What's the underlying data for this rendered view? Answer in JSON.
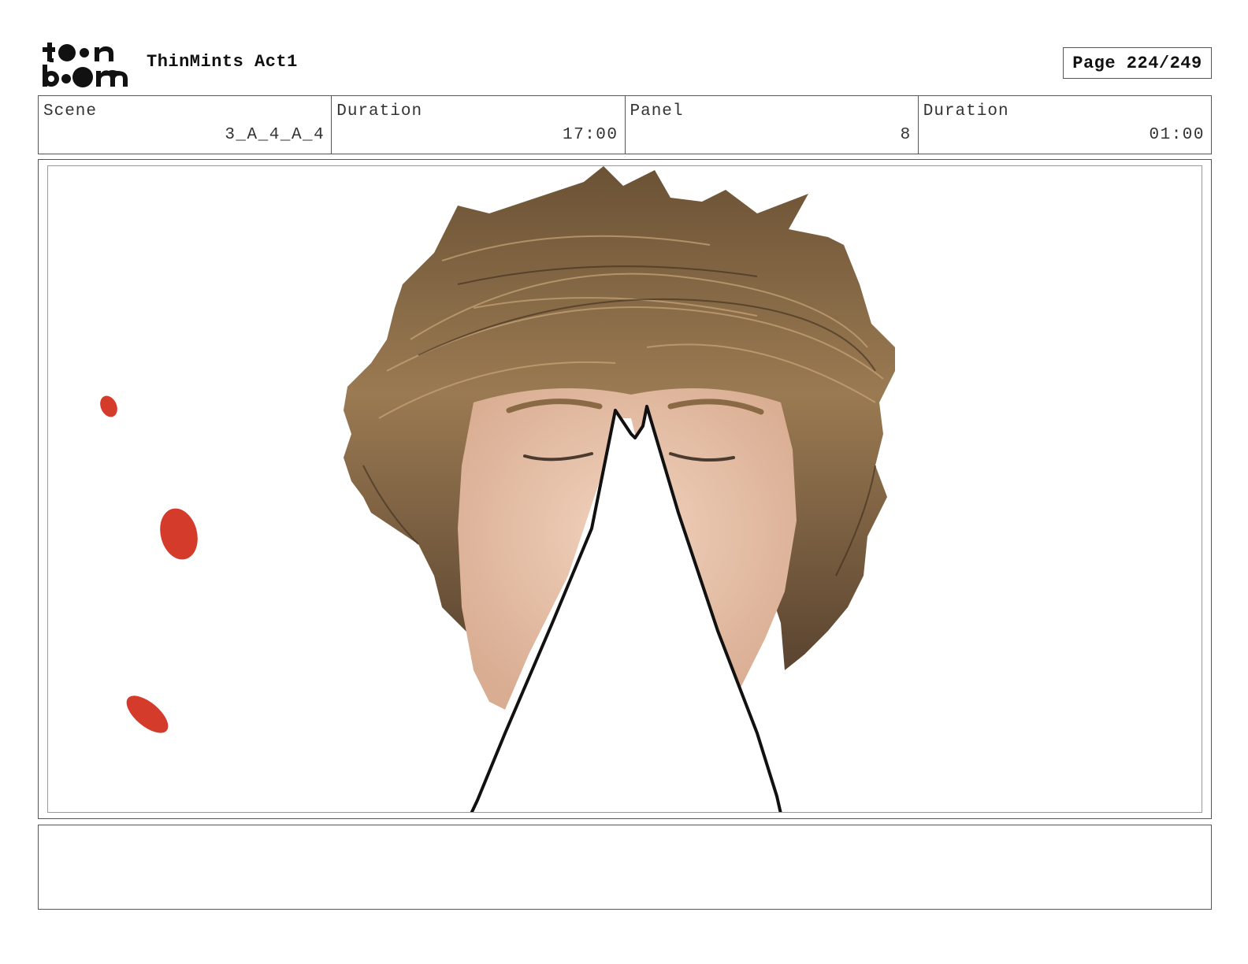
{
  "header": {
    "project_title": "ThinMints Act1",
    "page_label": "Page 224/249"
  },
  "info": {
    "scene_label": "Scene",
    "scene_value": "3_A_4_A_4",
    "scene_duration_label": "Duration",
    "scene_duration_value": "17:00",
    "panel_label": "Panel",
    "panel_value": "8",
    "panel_duration_label": "Duration",
    "panel_duration_value": "01:00"
  },
  "notes": {
    "text": ""
  },
  "colors": {
    "hair": "#8a6a45",
    "hair_dark": "#4e3b26",
    "skin": "#e9c4ad",
    "blood": "#d43b2b",
    "line": "#111111"
  }
}
